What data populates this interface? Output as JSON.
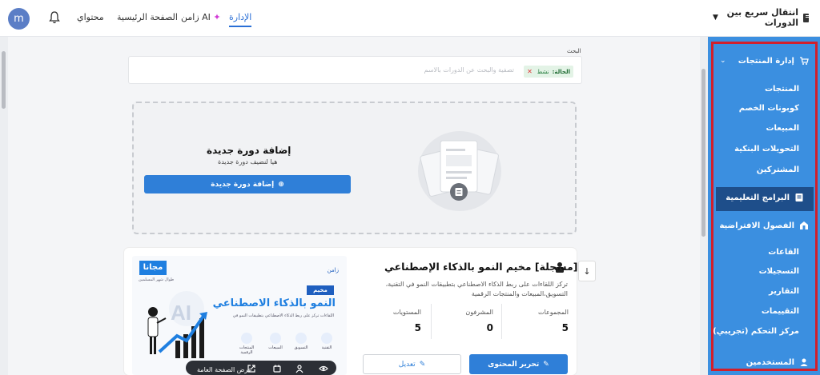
{
  "topbar": {
    "avatar_initial": "m",
    "nav_content": "محتواي",
    "nav_home": "الصفحة الرئيسية",
    "nav_ai": "زامن AI",
    "nav_admin": "الإدارة",
    "quick_switch": "انتقال سريع بين الدورات"
  },
  "sidebar": {
    "products_section": "إدارة المنتجات",
    "products": "المنتجات",
    "coupons": "كوبونات الخصم",
    "sales": "المبيعات",
    "bank_transfers": "التحويلات البنكية",
    "subscribers": "المشتركين",
    "programs": "البرامج التعليمية",
    "virtual_classes_section": "الفصول الافتراضية",
    "halls": "القاعات",
    "recordings": "التسجيلات",
    "reports": "التقارير",
    "evaluations": "التقييمات",
    "control_center": "مركز التحكم (تجريبي)",
    "users": "المستخدمين"
  },
  "search": {
    "label": "البحث",
    "chip_prefix": "الحالة:",
    "chip_value": "نشط",
    "placeholder": "تصفية والبحث عن الدورات بالاسم"
  },
  "add_course": {
    "title": "إضافة دورة جديدة",
    "subtitle": "هيا لنضيف دورة جديدة",
    "button": "إضافة دورة جديدة"
  },
  "course": {
    "title": "[مسجلة] مخيم النمو بالذكاء الإصطناعي",
    "description": "تركز اللقاءات على ربط الذكاء الاصطناعي بتطبيقات النمو في التقنية، التسويق،المبيعات والمنتجات الرقمية",
    "stats": [
      {
        "label": "المجموعات",
        "value": "5"
      },
      {
        "label": "المشرفون",
        "value": "0"
      },
      {
        "label": "المستويات",
        "value": "5"
      }
    ],
    "edit_content": "تحرير المحتوى",
    "edit": "تعديل",
    "view_public": "عرض الصفحة العامة"
  },
  "banner": {
    "badge": "مجانا",
    "badge_sub": "طوال شهر المسلمين",
    "logo": "زامن",
    "camp": "مخيم",
    "headline": "النمو بالذكاء الاصطناعي",
    "subline": "اللقاءات تركز على ربط الذكاء الاصطناعي بتطبيقات النمو في",
    "tags": [
      "التقنية",
      "التسويق",
      "المبيعات",
      "المنتجات الرقمية"
    ],
    "ai_mark": "AI"
  }
}
